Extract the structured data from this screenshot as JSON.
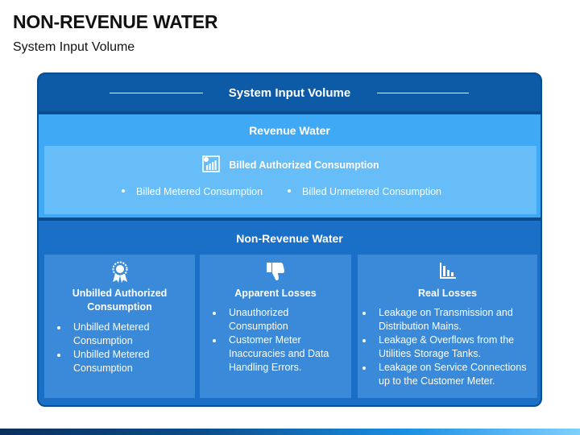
{
  "header": {
    "title": "NON-REVENUE WATER",
    "subtitle": "System Input Volume"
  },
  "system_input": {
    "label": "System Input Volume"
  },
  "revenue_water": {
    "label": "Revenue Water",
    "billed_authorized": {
      "label": "Billed Authorized Consumption",
      "icon": "bar-chart-icon",
      "items": [
        "Billed Metered Consumption",
        "Billed Unmetered Consumption"
      ]
    }
  },
  "non_revenue_water": {
    "label": "Non-Revenue Water",
    "columns": [
      {
        "title": "Unbilled Authorized Consumption",
        "icon": "award-ribbon-icon",
        "items": [
          "Unbilled Metered Consumption",
          "Unbilled Metered Consumption"
        ]
      },
      {
        "title": "Apparent Losses",
        "icon": "thumbs-down-icon",
        "items": [
          "Unauthorized Consumption",
          "Customer Meter Inaccuracies and Data Handling Errors."
        ]
      },
      {
        "title": "Real Losses",
        "icon": "bar-chart-icon",
        "items": [
          "Leakage on Transmission and Distribution Mains.",
          "Leakage & Overflows from the Utilities Storage Tanks.",
          "Leakage on Service Connections up to the Customer Meter."
        ]
      }
    ]
  },
  "colors": {
    "frame": "#0b4d8c",
    "system_input_bg": "#0d5aa7",
    "revenue_bg": "#3fa9f5",
    "revenue_inner_bg": "#66bdf7",
    "non_revenue_bg": "#1a6fc7",
    "column_bg": "#3a8ad9"
  }
}
